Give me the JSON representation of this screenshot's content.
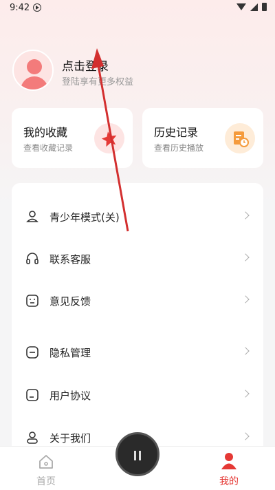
{
  "status_bar": {
    "time": "9:42"
  },
  "profile": {
    "title": "点击登录",
    "subtitle": "登陆享有更多权益"
  },
  "cards": [
    {
      "title": "我的收藏",
      "subtitle": "查看收藏记录",
      "icon": "star-icon"
    },
    {
      "title": "历史记录",
      "subtitle": "查看历史播放",
      "icon": "history-icon"
    }
  ],
  "menu": {
    "items": [
      {
        "label": "青少年模式(关)",
        "icon": "teen-mode-icon"
      },
      {
        "label": "联系客服",
        "icon": "headset-icon"
      },
      {
        "label": "意见反馈",
        "icon": "feedback-icon"
      },
      {
        "label": "隐私管理",
        "icon": "privacy-icon"
      },
      {
        "label": "用户协议",
        "icon": "agreement-icon"
      },
      {
        "label": "关于我们",
        "icon": "about-icon"
      }
    ]
  },
  "tabbar": {
    "home": {
      "label": "首页"
    },
    "me": {
      "label": "我的"
    }
  },
  "colors": {
    "accent": "#e53935",
    "orange": "#f59b3c"
  }
}
